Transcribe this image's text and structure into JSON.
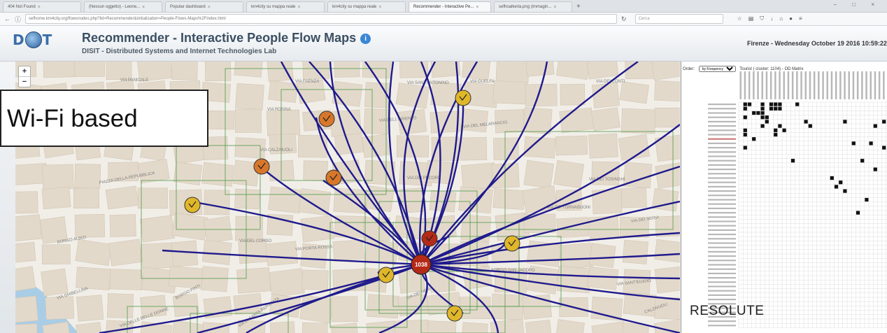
{
  "browser": {
    "tabs": [
      {
        "label": "404 Not Found"
      },
      {
        "label": "(Nessun oggetto) - Leone..."
      },
      {
        "label": "Popular dashboard"
      },
      {
        "label": "km4city su mappa reale"
      },
      {
        "label": "km4city su mappa reale"
      },
      {
        "label": "Recommender - Interactive Pe..."
      },
      {
        "label": "sefhoalkerla.png (immagin..."
      }
    ],
    "active_tab_index": 5,
    "url": "sefhome.km4city.org/flowsnodes.php?lid=Recommender&initialization=People-Flows-Maps%2Findex.html",
    "search_placeholder": "Cerca"
  },
  "header": {
    "logo_left": "D",
    "logo_right": "T",
    "title": "Recommender - Interactive People Flow Maps",
    "subtitle": "DISIT - Distributed Systems and Internet Technologies Lab",
    "datetime": "Firenze - Wednesday October 19 2016 10:59:22"
  },
  "map": {
    "zoom_in": "+",
    "zoom_out": "−",
    "center_node_label": "1038",
    "line_color": "#1f1a8c",
    "cluster_box_color": "#4f9a4a",
    "node_colors": [
      "#d8772b",
      "#e0b72a",
      "#b52a17"
    ],
    "streets": [
      "VIA PANICALE",
      "VIA FAENZA",
      "VIA SANT'ANTONINO",
      "VIA GUELFA",
      "VIA DEI CONTI",
      "VIA ROSINA",
      "VIA DELL'ARIENTO",
      "VIA DEL MELARANCIO",
      "VIA DE' CERRETANI",
      "VIA CALZAIUOLI",
      "VIA DEI PECORI",
      "VIA DEI TOSINGHI",
      "PIAZZA DELLA REPUBBLICA",
      "VIA DE' TORNABUONI",
      "VIA DEI SERVI",
      "BORGO ALBIZI",
      "VIA DEL CORSO",
      "VIA PORTA ROSSA",
      "BORGO SAN JACOPO",
      "VIA DEI NERI",
      "VIA GHIBELLINA",
      "BORGO PINTI",
      "VIA SANT'EGIDIO",
      "CALZAIUOLI",
      "VIA DELLE BELLE DONNE",
      "VIA DI SANTA REPARATA"
    ]
  },
  "callout": {
    "text": "Wi-Fi based"
  },
  "od_panel": {
    "order_label": "Order:",
    "order_value": "by Frequency",
    "title": "Tourist ( cluster: 1104) - OD Matrix",
    "filled_cells": [
      [
        0,
        1
      ],
      [
        0,
        2
      ],
      [
        0,
        5
      ],
      [
        0,
        7
      ],
      [
        0,
        8
      ],
      [
        0,
        9
      ],
      [
        0,
        13
      ],
      [
        1,
        1
      ],
      [
        1,
        5
      ],
      [
        1,
        7
      ],
      [
        1,
        8
      ],
      [
        1,
        9
      ],
      [
        2,
        3
      ],
      [
        2,
        4
      ],
      [
        2,
        5
      ],
      [
        3,
        1
      ],
      [
        3,
        5
      ],
      [
        3,
        6
      ],
      [
        4,
        6
      ],
      [
        4,
        15
      ],
      [
        4,
        24
      ],
      [
        4,
        33
      ],
      [
        5,
        5
      ],
      [
        5,
        9
      ],
      [
        5,
        16
      ],
      [
        5,
        31
      ],
      [
        6,
        1
      ],
      [
        6,
        8
      ],
      [
        6,
        10
      ],
      [
        7,
        1
      ],
      [
        7,
        8
      ],
      [
        8,
        3
      ],
      [
        9,
        26
      ],
      [
        9,
        30
      ],
      [
        10,
        1
      ],
      [
        10,
        33
      ],
      [
        13,
        12
      ],
      [
        13,
        28
      ],
      [
        15,
        31
      ],
      [
        17,
        21
      ],
      [
        18,
        23
      ],
      [
        19,
        22
      ],
      [
        20,
        24
      ],
      [
        22,
        29
      ],
      [
        25,
        27
      ]
    ],
    "grid_size": 36
  },
  "footer_text": "RESOLUTE"
}
